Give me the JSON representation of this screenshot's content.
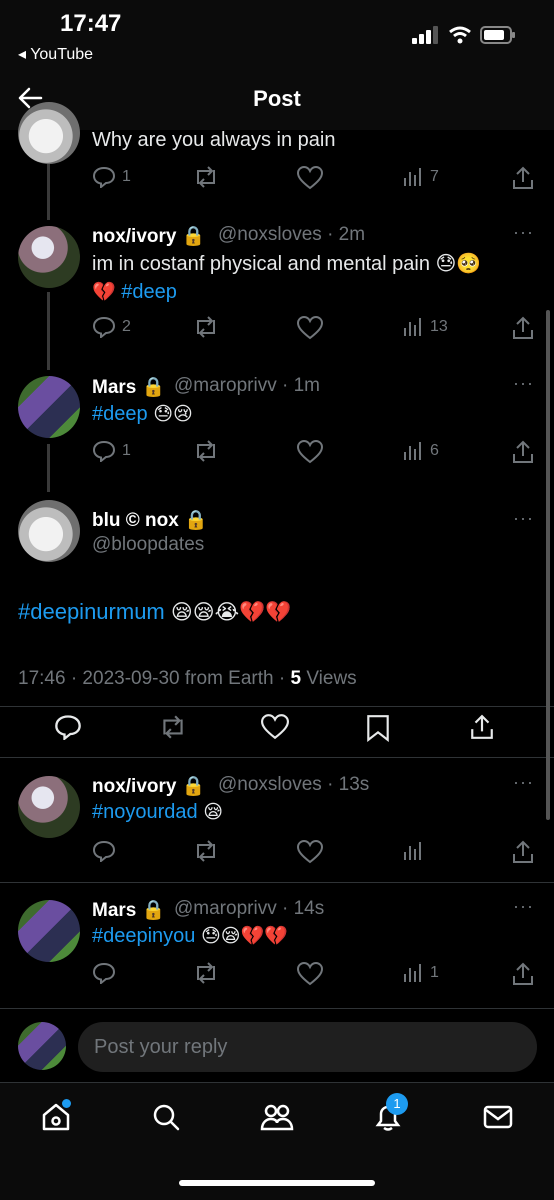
{
  "status": {
    "time": "17:47",
    "back_app": "◂ YouTube"
  },
  "header": {
    "title": "Post"
  },
  "icons": {
    "reply": "reply-icon",
    "repost": "repost-icon",
    "like": "heart-icon",
    "views": "views-icon",
    "share": "share-icon",
    "bookmark": "bookmark-icon"
  },
  "accent": "#1d9bf0",
  "thread": [
    {
      "body": "Why are you always in pain",
      "stats": {
        "replies": "1",
        "views": "7"
      }
    },
    {
      "name": "nox/ivory",
      "handle": "@noxsloves",
      "time": "· 2m",
      "line1": "im in costanf physical and mental pain 😓🥺",
      "line2_emoji": "💔",
      "line2_tag": "#deep",
      "stats": {
        "replies": "2",
        "views": "13"
      }
    },
    {
      "name": "Mars",
      "handle": "@maroprivv",
      "time": "· 1m",
      "tag": "#deep",
      "emoji": "😓😢",
      "stats": {
        "replies": "1",
        "views": "6"
      }
    }
  ],
  "main_post": {
    "name": "blu © nox",
    "handle": "@bloopdates",
    "tag": "#deepinurmum",
    "emoji": "😪😪😭💔💔",
    "meta_time": "17:46 · 2023-09-30 from Earth ·",
    "views_count": "5",
    "views_label": "Views"
  },
  "replies": [
    {
      "name": "nox/ivory",
      "handle": "@noxsloves",
      "time": "· 13s",
      "tag": "#noyourdad",
      "emoji": "😪"
    },
    {
      "name": "Mars",
      "handle": "@maroprivv",
      "time": "· 14s",
      "tag": "#deepinyou",
      "emoji": "😓😪💔💔",
      "views": "1"
    }
  ],
  "reply_bar": {
    "placeholder": "Post your reply"
  },
  "tabbar": {
    "notifications_badge": "1"
  },
  "more_label": "···"
}
